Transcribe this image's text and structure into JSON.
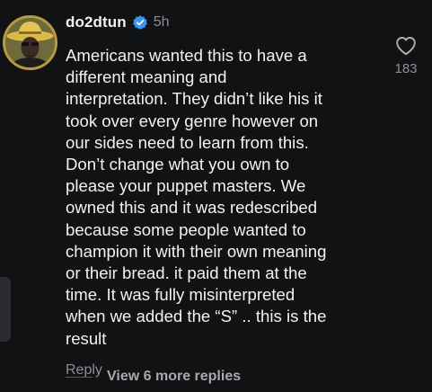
{
  "comment": {
    "username": "do2dtun",
    "verified_icon": "verified-badge-icon",
    "timestamp": "5h",
    "body": "Americans wanted this to have a\ndifferent meaning and\ninterpretation. They didn’t like his it\ntook over every genre however on\nour sides need to learn from this.\nDon’t change what you own to\nplease your puppet masters. We\nowned this and it was redescribed\nbecause some people wanted to\nchampion it with their own meaning\nor their bread. it paid them at the\ntime. It was fully misinterpreted\nwhen we added the “S” .. this is the\nresult",
    "reply_label": "Reply",
    "like_icon": "heart-outline-icon",
    "like_count": "183"
  },
  "replies": {
    "view_more_label": "View 6 more replies"
  },
  "colors": {
    "background": "#101214",
    "text_primary": "#f2f2f2",
    "text_secondary": "#8e8e93",
    "verified_blue": "#3797f0",
    "avatar_ring": "#b89b3c"
  }
}
